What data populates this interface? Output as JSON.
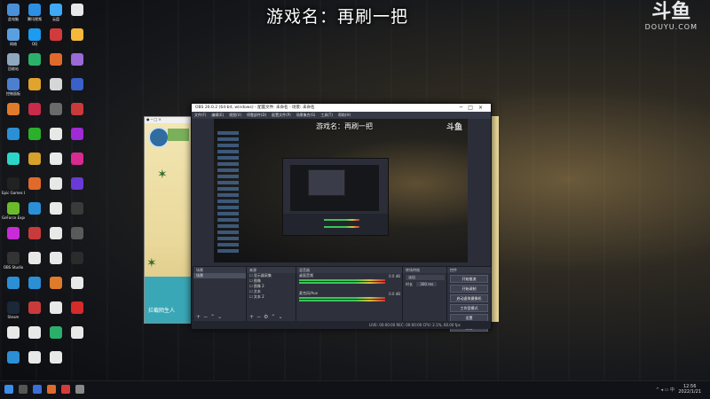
{
  "overlay_title": "游戏名：再刷一把",
  "logo": {
    "cn": "斗鱼",
    "en": "DOUYU.COM"
  },
  "desktop_icons": [
    {
      "label": "此电脑",
      "color": "#4a90d9"
    },
    {
      "label": "腾讯视频",
      "color": "#2c8fe3"
    },
    {
      "label": "云盘",
      "color": "#3fa9f5"
    },
    {
      "label": "",
      "color": "#e8e8e8"
    },
    {
      "label": "网络",
      "color": "#5aa0e0"
    },
    {
      "label": "QQ",
      "color": "#1c9bf0"
    },
    {
      "label": "",
      "color": "#d23b3b"
    },
    {
      "label": "",
      "color": "#f5b83a"
    },
    {
      "label": "回收站",
      "color": "#8fa8c0"
    },
    {
      "label": "",
      "color": "#2bb06b"
    },
    {
      "label": "",
      "color": "#e06a2b"
    },
    {
      "label": "",
      "color": "#9a6ad6"
    },
    {
      "label": "控制面板",
      "color": "#4c7fd0"
    },
    {
      "label": "",
      "color": "#e0a32b"
    },
    {
      "label": "",
      "color": "#d6d6d6"
    },
    {
      "label": "",
      "color": "#3a60c9"
    },
    {
      "label": "",
      "color": "#e07b2b"
    },
    {
      "label": "",
      "color": "#c92b4a"
    },
    {
      "label": "",
      "color": "#6a6a6a"
    },
    {
      "label": "",
      "color": "#c93b3b"
    },
    {
      "label": "",
      "color": "#2b8fd6"
    },
    {
      "label": "",
      "color": "#2bb02b"
    },
    {
      "label": "",
      "color": "#e8e8e8"
    },
    {
      "label": "",
      "color": "#a02bd6"
    },
    {
      "label": "",
      "color": "#2bd6c9"
    },
    {
      "label": "",
      "color": "#d6a02b"
    },
    {
      "label": "",
      "color": "#e8e8e8"
    },
    {
      "label": "",
      "color": "#d62b8f"
    },
    {
      "label": "Epic Games Launcher",
      "color": "#222"
    },
    {
      "label": "",
      "color": "#e06a2b"
    },
    {
      "label": "",
      "color": "#e8e8e8"
    },
    {
      "label": "",
      "color": "#6a3ad6"
    },
    {
      "label": "GeForce Experience",
      "color": "#6aba2b"
    },
    {
      "label": "",
      "color": "#2b8fd6"
    },
    {
      "label": "",
      "color": "#e8e8e8"
    },
    {
      "label": "",
      "color": "#3a3a3a"
    },
    {
      "label": "",
      "color": "#c92bd6"
    },
    {
      "label": "",
      "color": "#c93b3b"
    },
    {
      "label": "",
      "color": "#e8e8e8"
    },
    {
      "label": "",
      "color": "#5a5a5a"
    },
    {
      "label": "OBS Studio",
      "color": "#333"
    },
    {
      "label": "",
      "color": "#e8e8e8"
    },
    {
      "label": "",
      "color": "#e8e8e8"
    },
    {
      "label": "",
      "color": "#2b2b2b"
    },
    {
      "label": "",
      "color": "#2b8fd6"
    },
    {
      "label": "",
      "color": "#2b8fd6"
    },
    {
      "label": "",
      "color": "#e07b2b"
    },
    {
      "label": "",
      "color": "#e8e8e8"
    },
    {
      "label": "Steam",
      "color": "#1b2838"
    },
    {
      "label": "",
      "color": "#c93b3b"
    },
    {
      "label": "",
      "color": "#e8e8e8"
    },
    {
      "label": "",
      "color": "#d62b2b"
    },
    {
      "label": "",
      "color": "#e8e8e8"
    },
    {
      "label": "",
      "color": "#e8e8e8"
    },
    {
      "label": "",
      "color": "#2bb06b"
    },
    {
      "label": "",
      "color": "#e8e8e8"
    },
    {
      "label": "",
      "color": "#2b8fd6"
    },
    {
      "label": "",
      "color": "#e8e8e8"
    },
    {
      "label": "",
      "color": "#e8e8e8"
    }
  ],
  "game": {
    "caption": "拦截陌生人"
  },
  "obs": {
    "title": "OBS 26.0.2 (64-bit, windows) - 配置文件: 未命名 - 场景: 未命名",
    "menu": [
      "文件(F)",
      "编辑(E)",
      "视图(V)",
      "停靠部件(D)",
      "配置文件(P)",
      "场景集合(S)",
      "工具(T)",
      "帮助(H)"
    ],
    "preview_title": "游戏名：再刷一把",
    "preview_logo": "斗鱼",
    "docks": {
      "scenes": {
        "header": "场景",
        "items": [
          "场景"
        ]
      },
      "sources": {
        "header": "来源",
        "items": [
          "显示器采集",
          "图像",
          "图像 2",
          "文本",
          "文本 2"
        ]
      },
      "mixer": {
        "header": "混音器",
        "rows": [
          {
            "name": "桌面音频",
            "db": "0.0 dB"
          },
          {
            "name": "麦克风/Aux",
            "db": "0.0 dB"
          }
        ]
      },
      "transitions": {
        "header": "转场特效",
        "type": "淡出",
        "duration_label": "时长",
        "duration": "300 ms"
      },
      "controls": {
        "header": "控件",
        "buttons": [
          "开始推流",
          "开始录制",
          "启动虚拟摄像机",
          "工作室模式",
          "设置",
          "退出"
        ]
      }
    },
    "status": "LIVE: 00:00:00   REC: 00:00:00   CPU: 2.1%, 60.00 fps"
  },
  "taskbar": {
    "time": "12:56",
    "date": "2022/1/21"
  }
}
